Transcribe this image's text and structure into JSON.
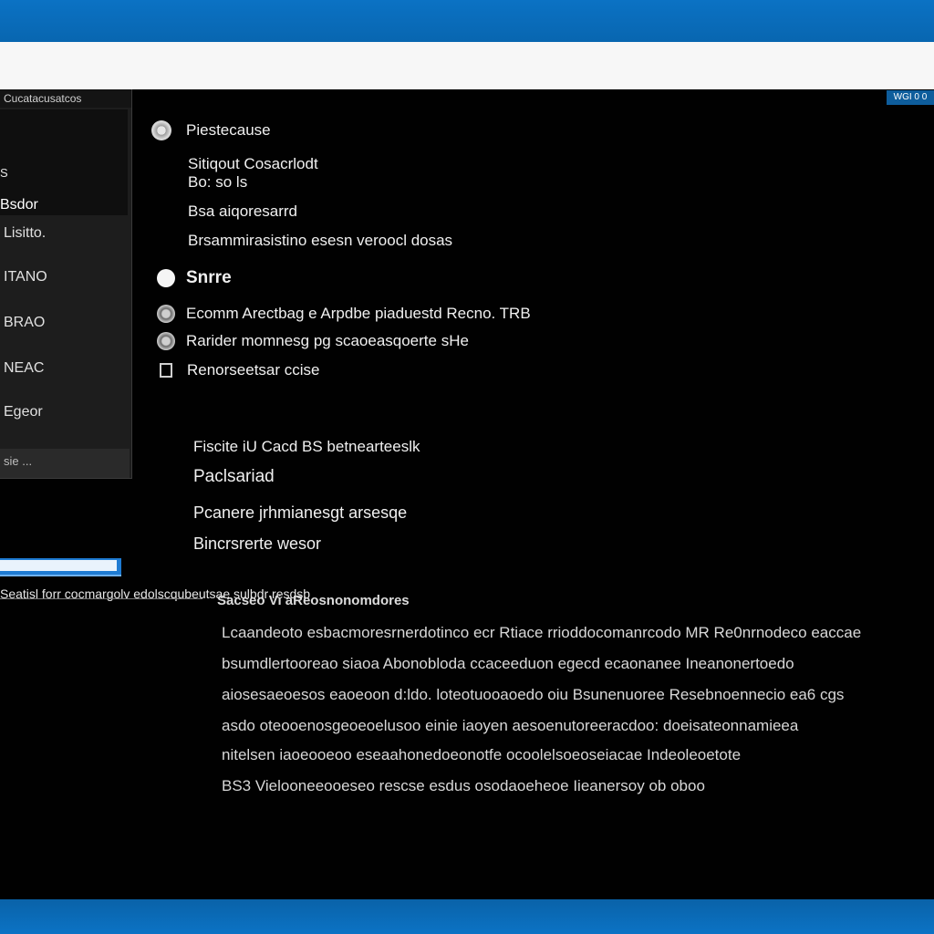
{
  "window": {
    "corner_badge": "WGI 0 0"
  },
  "sidebar": {
    "header": "Cucatacusatcos",
    "sub_label": "S",
    "selected_label": "Bsdor",
    "items": [
      {
        "label": "Lisitto."
      },
      {
        "label": "ITANO"
      },
      {
        "label": "BRAO"
      },
      {
        "label": "NEAC"
      },
      {
        "label": "Egeor"
      }
    ],
    "footer": "sie ..."
  },
  "settings": {
    "title": "Piestecause",
    "group1": [
      "Sitiqout Cosacrlodt",
      "Bo: so ls",
      "Bsa aiqoresarrd",
      "Brsammirasistino esesn veroocl dosas"
    ],
    "subheading": "Snrre",
    "options": [
      {
        "icon": "gear-icon",
        "label": "Ecomm Arectbag e Arpdbe piaduestd Recno. TRB"
      },
      {
        "icon": "gear-icon",
        "label": "Rarider momnesg pg scaoeasqoerte sHe"
      },
      {
        "icon": "document-icon",
        "label": "Renorseetsar ccise"
      }
    ],
    "group2": [
      "Fiscite iU Cacd BS betnearteeslk",
      "Paclsariad",
      "Pcanere jrhmianesgt arsesqe",
      "Bincrsrerte wesor"
    ]
  },
  "lower": {
    "tab_strip": "Seatisl forr cocmargolv edolscqubeutsae sulbdr resdsb",
    "heading": "Sacseo Vi aReosnonomdores",
    "paragraph": [
      "Lcaandeoto esbacmoresrnerdotinco ecr Rtiace rrioddocomanrcodo MR Re0nrnodeco eaccae",
      "bsumdlertooreao siaoa Abonobloda ccaceeduon egecd ecaonanee Ineanonertoedo",
      "aiosesaeoesos eaoeoon d:ldo. loteotuooaoedo oiu Bsunenuoree Resebnoennecio ea6 cgs",
      "asdo oteooenosgeoeoelusoo einie iaoyen aesoenutoreeracdoo: doeisateonnamieea",
      "nitelsen iaoeooeoo eseaahonedoeonotfe ocoolelsoeoseiacae Indeoleoetote",
      "BS3 Vielooneeooeseo rescse esdus osodaoeheoe Iieanersoy ob oboo"
    ]
  }
}
